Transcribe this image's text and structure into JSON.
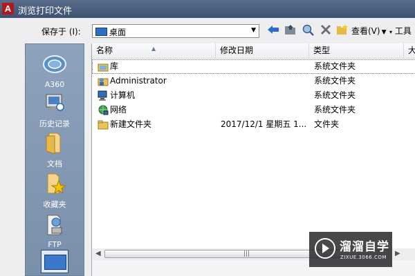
{
  "window": {
    "title": "浏览打印文件",
    "app_logo": "A"
  },
  "toolbar": {
    "save_in_label": "保存于 (I):",
    "location": "桌面",
    "view_label": "查看(V)",
    "tools_label": "工具",
    "icons": [
      "back-arrow-icon",
      "up-folder-icon",
      "search-web-icon",
      "delete-icon",
      "new-folder-icon"
    ]
  },
  "sidebar": {
    "items": [
      {
        "label": "A360",
        "icon": "a360-icon"
      },
      {
        "label": "历史记录",
        "icon": "history-icon"
      },
      {
        "label": "文档",
        "icon": "documents-icon"
      },
      {
        "label": "收藏夹",
        "icon": "favorites-icon"
      },
      {
        "label": "FTP",
        "icon": "ftp-icon"
      },
      {
        "label": "",
        "icon": "desktop-icon"
      }
    ]
  },
  "filelist": {
    "columns": [
      "名称",
      "修改日期",
      "类型",
      "大"
    ],
    "rows": [
      {
        "name": "库",
        "date": "",
        "type": "系统文件夹",
        "icon": "library-icon",
        "selected": true
      },
      {
        "name": "Administrator",
        "date": "",
        "type": "系统文件夹",
        "icon": "user-folder-icon",
        "selected": false
      },
      {
        "name": "计算机",
        "date": "",
        "type": "系统文件夹",
        "icon": "computer-icon",
        "selected": false
      },
      {
        "name": "网络",
        "date": "",
        "type": "系统文件夹",
        "icon": "network-icon",
        "selected": false
      },
      {
        "name": "新建文件夹",
        "date": "2017/12/1 星期五 1...",
        "type": "文件夹",
        "icon": "folder-icon",
        "selected": false
      }
    ],
    "scroll_grip": "|||"
  },
  "watermark": {
    "name": "溜溜自学",
    "url": "ZIXUE.3066.COM"
  }
}
